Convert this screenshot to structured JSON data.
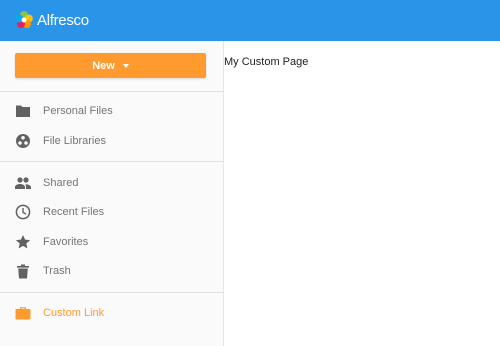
{
  "app": {
    "logo_text": "Alfresco",
    "colors": {
      "header": "#2a95e8",
      "accent": "#ff9a2e",
      "nav_text": "#757575",
      "nav_icon": "#616161"
    }
  },
  "sidebar": {
    "new_button": {
      "label": "New",
      "icon": "caret-down-icon"
    },
    "groups": [
      [
        {
          "label": "Personal Files",
          "icon": "folder-icon"
        },
        {
          "label": "File Libraries",
          "icon": "libraries-icon"
        }
      ],
      [
        {
          "label": "Shared",
          "icon": "people-icon"
        },
        {
          "label": "Recent Files",
          "icon": "clock-icon"
        },
        {
          "label": "Favorites",
          "icon": "star-icon"
        },
        {
          "label": "Trash",
          "icon": "trash-icon"
        }
      ],
      [
        {
          "label": "Custom Link",
          "icon": "briefcase-icon"
        }
      ]
    ]
  },
  "main": {
    "text": "My Custom Page"
  }
}
